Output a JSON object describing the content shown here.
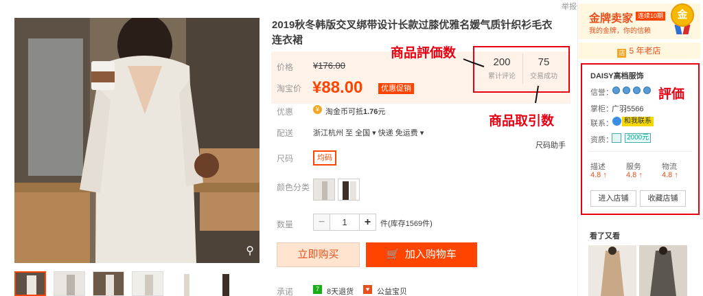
{
  "report_link": "举报",
  "title": "2019秋冬韩版交叉绑带设计长款过膝优雅名媛气质针织衫毛衣连衣裙",
  "price": {
    "original_label": "价格",
    "original": "¥176.00",
    "current_label": "淘宝价",
    "current": "¥88.00",
    "promo_badge": "优惠促销"
  },
  "stats": {
    "reviews_value": "200",
    "reviews_label": "累计评论",
    "trades_value": "75",
    "trades_label": "交易成功"
  },
  "annotations": {
    "reviews": "商品評価数",
    "trades": "商品取引数",
    "rating": "評価"
  },
  "offer": {
    "label": "优惠",
    "coin_prefix": "淘金币可抵",
    "coin_amount": "1.76",
    "coin_suffix": "元"
  },
  "shipping": {
    "label": "配送",
    "text": "浙江杭州 至 全国 ▾   快递 免运费 ▾"
  },
  "size_help": "尺码助手",
  "size": {
    "label": "尺码",
    "option": "均码"
  },
  "color_label": "颜色分类",
  "quantity": {
    "label": "数量",
    "minus": "−",
    "value": "1",
    "plus": "+",
    "stock": "件(库存1569件)"
  },
  "buttons": {
    "buy_now": "立即购买",
    "add_cart": "加入购物车"
  },
  "promise": {
    "label": "承诺",
    "item1_icon": "7",
    "item1": "8天退货",
    "item2": "公益宝贝"
  },
  "seller": {
    "gold_title": "金牌卖家",
    "gold_badge": "连续10期",
    "gold_sub": "我的金牌，你的信赖",
    "medal": "金",
    "years": "5 年老店",
    "years_icon": "店",
    "shop_name": "DAISY高档服饰",
    "credit_label": "信誉：",
    "keeper_label": "掌柜：",
    "keeper_value": "广羽5566",
    "contact_label": "联系：",
    "contact_value": "和我联系",
    "qual_label": "资质：",
    "deposit": "2000元",
    "scores": [
      {
        "label": "描述",
        "value": "4.8 ↑"
      },
      {
        "label": "服务",
        "value": "4.8 ↑"
      },
      {
        "label": "物流",
        "value": "4.8 ↑"
      }
    ],
    "enter_shop": "进入店铺",
    "fav_shop": "收藏店铺"
  },
  "also_viewed": "看了又看",
  "colors": {
    "accent": "#ff4400",
    "annotation_red": "#e60012",
    "price_bg": "#fff2e8"
  }
}
